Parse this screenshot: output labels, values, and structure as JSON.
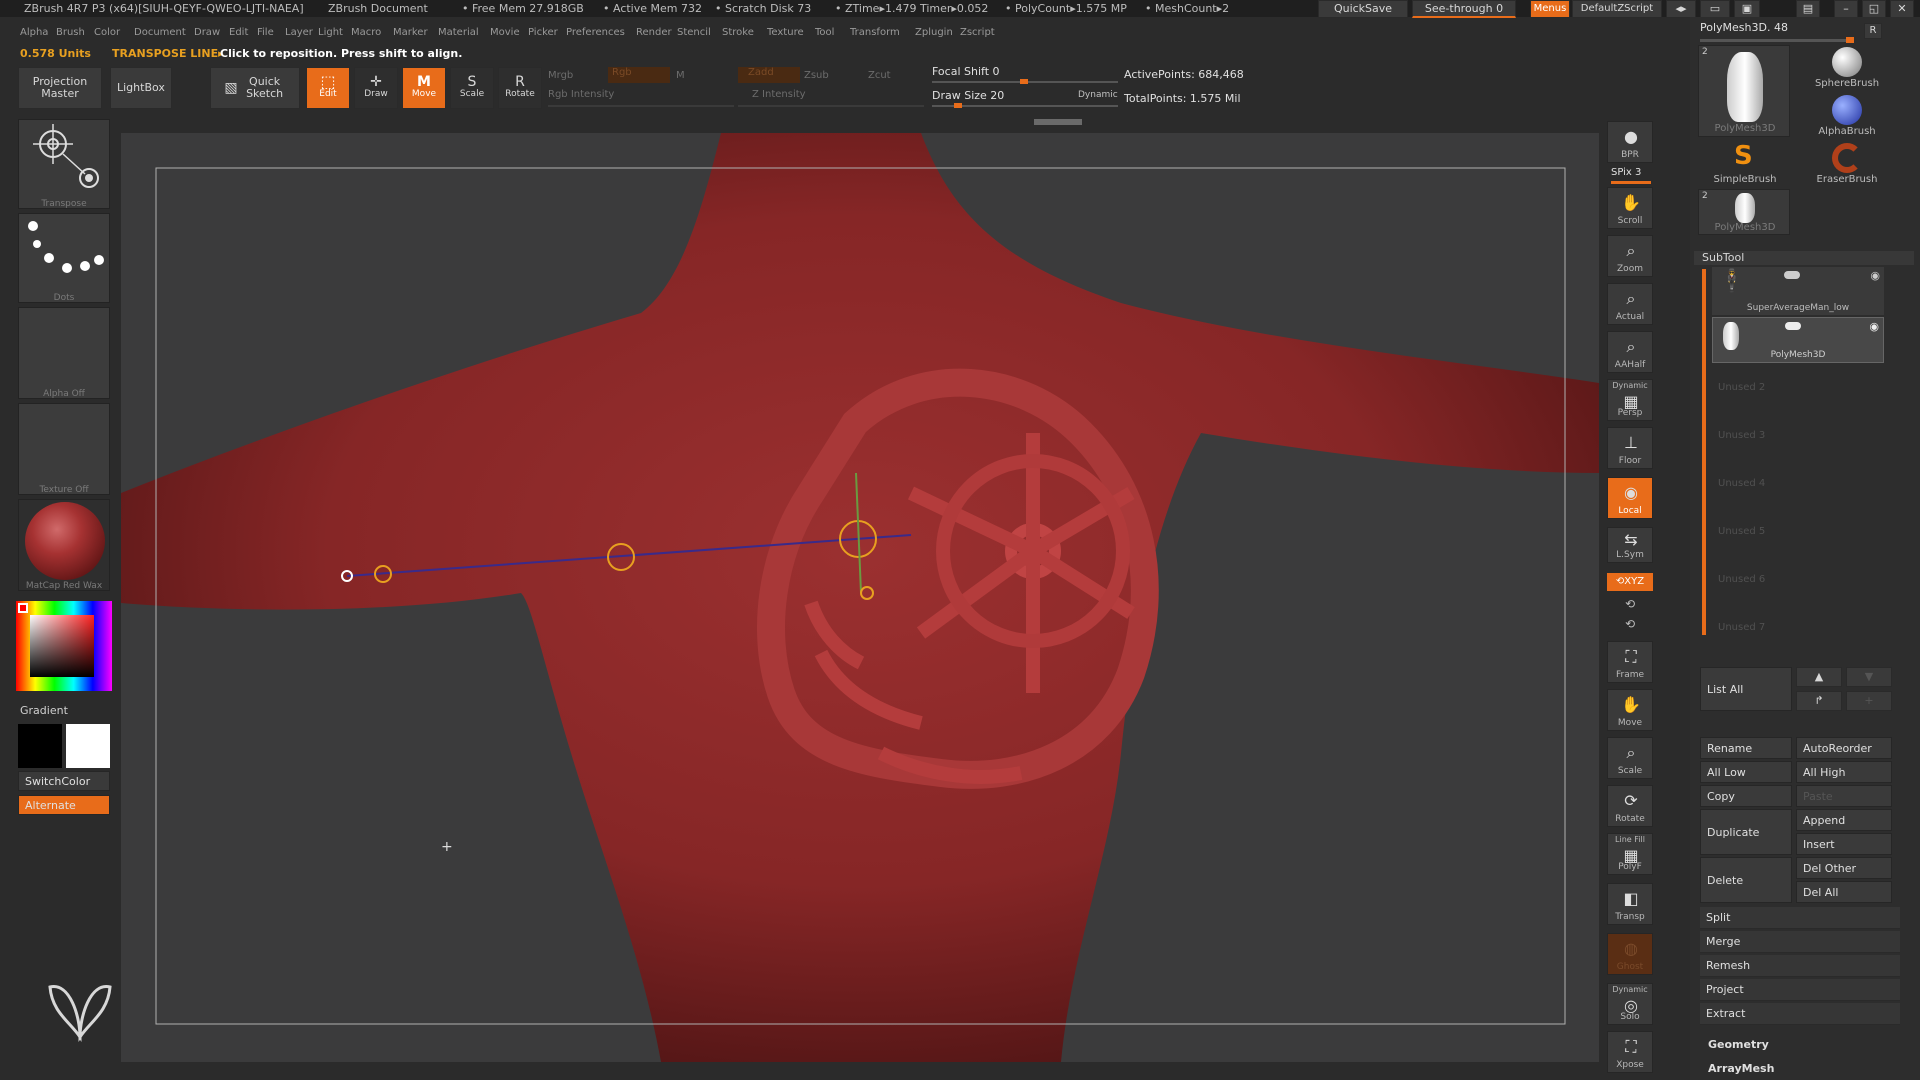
{
  "title_bar": {
    "app": "ZBrush 4R7 P3 (x64)[SIUH-QEYF-QWEO-LJTI-NAEA]",
    "document": "ZBrush Document",
    "free_mem": "• Free Mem 27.918GB",
    "active_mem": "• Active Mem 732",
    "scratch_disk": "• Scratch Disk 73",
    "ztime": "• ZTime▸1.479 Timer▸0.052",
    "polycount": "• PolyCount▸1.575 MP",
    "meshcount": "• MeshCount▸2",
    "quicksave": "QuickSave",
    "see_through": "See-through  0",
    "menus": "Menus",
    "default_zscript": "DefaultZScript"
  },
  "menu_bar": [
    "Alpha",
    "Brush",
    "Color",
    "Document",
    "Draw",
    "Edit",
    "File",
    "Layer",
    "Light",
    "Macro",
    "Marker",
    "Material",
    "Movie",
    "Picker",
    "Preferences",
    "Render",
    "Stencil",
    "Stroke",
    "Texture",
    "Tool",
    "Transform",
    "Zplugin",
    "Zscript"
  ],
  "status": {
    "units": "0.578 Units",
    "mode": "TRANSPOSE LINE▸",
    "hint": "Click to reposition. Press shift to align."
  },
  "top_shelf": {
    "projection_master": "Projection Master",
    "lightbox": "LightBox",
    "quick_sketch": "Quick Sketch",
    "edit": "Edit",
    "draw": "Draw",
    "move": "Move",
    "scale": "Scale",
    "rotate": "Rotate",
    "mrgb": "Mrgb",
    "rgb": "Rgb",
    "m": "M",
    "rgb_intensity": "Rgb Intensity",
    "zadd": "Zadd",
    "zsub": "Zsub",
    "zcut": "Zcut",
    "z_intensity": "Z Intensity",
    "focal_shift": "Focal Shift 0",
    "draw_size": "Draw Size 20",
    "dynamic": "Dynamic",
    "active_points": "ActivePoints: 684,468",
    "total_points": "TotalPoints: 1.575 Mil"
  },
  "left_panel": {
    "transpose": "Transpose",
    "dots": "Dots",
    "alpha_off": "Alpha Off",
    "texture_off": "Texture Off",
    "matcap": "MatCap Red Wax",
    "gradient": "Gradient",
    "switch_color": "SwitchColor",
    "alternate": "Alternate"
  },
  "right_tools": {
    "bpr": "BPR",
    "spix": "SPix 3",
    "scroll": "Scroll",
    "zoom": "Zoom",
    "actual": "Actual",
    "aahalf": "AAHalf",
    "dynamic": "Dynamic",
    "persp": "Persp",
    "floor": "Floor",
    "local": "Local",
    "lsym": "L.Sym",
    "xyz": "⟲XYZ",
    "frame": "Frame",
    "move": "Move",
    "scale": "Scale",
    "rotate": "Rotate",
    "line_fill": "Line Fill",
    "polyf": "PolyF",
    "transp": "Transp",
    "ghost": "Ghost",
    "dynamic2": "Dynamic",
    "solo": "Solo",
    "xpose": "Xpose"
  },
  "right_panel": {
    "tool_title": "PolyMesh3D. 48",
    "r": "R",
    "tools": {
      "polymesh": "PolyMesh3D",
      "sphere": "SphereBrush",
      "alpha": "AlphaBrush",
      "simple": "SimpleBrush",
      "eraser": "EraserBrush",
      "polymesh2": "PolyMesh3D",
      "count_a": "2",
      "count_b": "2"
    },
    "subtool_header": "SubTool",
    "subtools": [
      "SuperAverageMan_low",
      "PolyMesh3D"
    ],
    "unused": [
      "Unused 2",
      "Unused 3",
      "Unused 4",
      "Unused 5",
      "Unused 6",
      "Unused 7"
    ],
    "list_all": "List  All",
    "rename": "Rename",
    "auto_reorder": "AutoReorder",
    "all_low": "All Low",
    "all_high": "All High",
    "copy": "Copy",
    "paste": "Paste",
    "duplicate": "Duplicate",
    "append": "Append",
    "insert": "Insert",
    "delete": "Delete",
    "del_other": "Del Other",
    "del_all": "Del All",
    "split": "Split",
    "merge": "Merge",
    "remesh": "Remesh",
    "project": "Project",
    "extract": "Extract",
    "geometry": "Geometry",
    "arraymesh": "ArrayMesh"
  },
  "colors": {
    "accent": "#e86c1a",
    "model_red": "#8e2a2a",
    "background": "#2b2b2b"
  }
}
